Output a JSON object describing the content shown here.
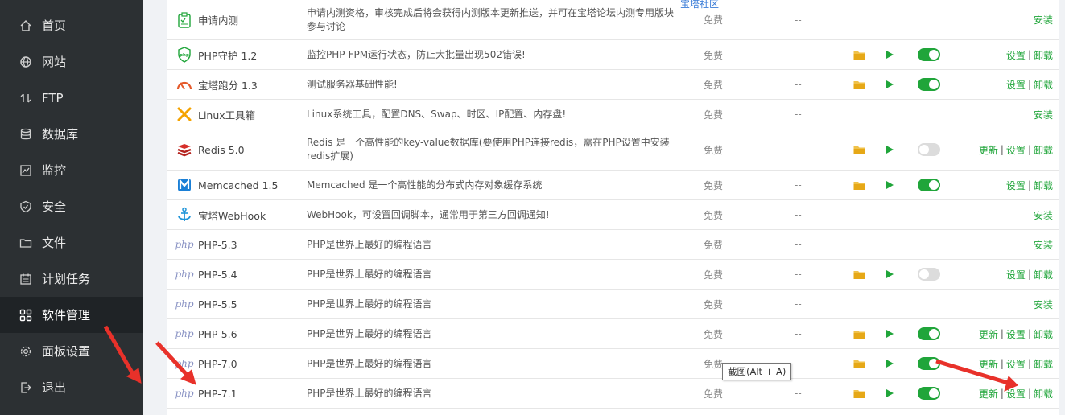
{
  "sidebar": {
    "items": [
      {
        "label": "首页",
        "icon": "home-icon"
      },
      {
        "label": "网站",
        "icon": "globe-icon"
      },
      {
        "label": "FTP",
        "icon": "ftp-icon"
      },
      {
        "label": "数据库",
        "icon": "database-icon"
      },
      {
        "label": "监控",
        "icon": "monitor-icon"
      },
      {
        "label": "安全",
        "icon": "shield-icon"
      },
      {
        "label": "文件",
        "icon": "folder-icon"
      },
      {
        "label": "计划任务",
        "icon": "calendar-icon"
      },
      {
        "label": "软件管理",
        "icon": "grid-icon",
        "active": true
      },
      {
        "label": "面板设置",
        "icon": "gear-icon"
      },
      {
        "label": "退出",
        "icon": "logout-icon"
      }
    ]
  },
  "top_note": "宝塔社区",
  "ops_labels": {
    "update": "更新",
    "settings": "设置",
    "uninstall": "卸载",
    "install": "安装",
    "sep": "|"
  },
  "rows": [
    {
      "name": "申请内测",
      "icon": "beta-icon",
      "desc": "申请内测资格，审核完成后将会获得内测版本更新推送，并可在宝塔论坛内测专用版块参与讨论",
      "price": "免费",
      "expire": "--",
      "installed": false
    },
    {
      "name": "PHP守护 1.2",
      "icon": "php-guard-icon",
      "desc": "监控PHP-FPM运行状态，防止大批量出现502错误!",
      "price": "免费",
      "expire": "--",
      "installed": true,
      "toggle": true,
      "update": false
    },
    {
      "name": "宝塔跑分 1.3",
      "icon": "gauge-icon",
      "desc": "测试服务器基础性能!",
      "price": "免费",
      "expire": "--",
      "installed": true,
      "toggle": true,
      "update": false
    },
    {
      "name": "Linux工具箱",
      "icon": "tools-icon",
      "desc": "Linux系统工具，配置DNS、Swap、时区、IP配置、内存盘!",
      "price": "免费",
      "expire": "--",
      "installed": false
    },
    {
      "name": "Redis 5.0",
      "icon": "redis-icon",
      "desc": "Redis 是一个高性能的key-value数据库(要使用PHP连接redis，需在PHP设置中安装redis扩展)",
      "price": "免费",
      "expire": "--",
      "installed": true,
      "toggle": false,
      "update": true
    },
    {
      "name": "Memcached 1.5",
      "icon": "memcached-icon",
      "desc": "Memcached 是一个高性能的分布式内存对象缓存系统",
      "price": "免费",
      "expire": "--",
      "installed": true,
      "toggle": true,
      "update": false
    },
    {
      "name": "宝塔WebHook",
      "icon": "anchor-icon",
      "desc": "WebHook，可设置回调脚本，通常用于第三方回调通知!",
      "price": "免费",
      "expire": "--",
      "installed": false
    },
    {
      "name": "PHP-5.3",
      "icon": "php-logo-icon",
      "desc": "PHP是世界上最好的编程语言",
      "price": "免费",
      "expire": "--",
      "installed": false
    },
    {
      "name": "PHP-5.4",
      "icon": "php-logo-icon",
      "desc": "PHP是世界上最好的编程语言",
      "price": "免费",
      "expire": "--",
      "installed": true,
      "toggle": false,
      "update": false
    },
    {
      "name": "PHP-5.5",
      "icon": "php-logo-icon",
      "desc": "PHP是世界上最好的编程语言",
      "price": "免费",
      "expire": "--",
      "installed": false
    },
    {
      "name": "PHP-5.6",
      "icon": "php-logo-icon",
      "desc": "PHP是世界上最好的编程语言",
      "price": "免费",
      "expire": "--",
      "installed": true,
      "toggle": true,
      "update": true
    },
    {
      "name": "PHP-7.0",
      "icon": "php-logo-icon",
      "desc": "PHP是世界上最好的编程语言",
      "price": "免费",
      "expire": "--",
      "installed": true,
      "toggle": true,
      "update": true
    },
    {
      "name": "PHP-7.1",
      "icon": "php-logo-icon",
      "desc": "PHP是世界上最好的编程语言",
      "price": "免费",
      "expire": "--",
      "installed": true,
      "toggle": true,
      "update": true
    }
  ],
  "tooltip": "截图(Alt + A)",
  "colors": {
    "sidebar_bg": "#2c3033",
    "sidebar_active": "#1f2326",
    "accent_green": "#20a53a",
    "folder_yellow": "#f0c24a",
    "annotation_red": "#e8312a"
  }
}
